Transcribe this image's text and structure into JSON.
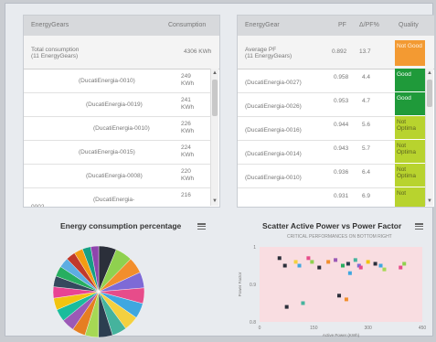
{
  "energy_table": {
    "col_gears": "EnergyGears",
    "col_consumption": "Consumption",
    "summary_label": "Total consumption",
    "summary_sub": "(11 EnergyGears)",
    "summary_value": "4306 KWh",
    "rows": [
      {
        "name": "(DucatiEnergia-0010)",
        "value": "249",
        "unit": "KWh"
      },
      {
        "name": "(DucatiEnergia-0019)",
        "value": "241",
        "unit": "KWh"
      },
      {
        "name": "(DucatiEnergia-0010)",
        "value": "226",
        "unit": "KWh"
      },
      {
        "name": "(DucatiEnergia-0015)",
        "value": "224",
        "unit": "KWh"
      },
      {
        "name": "(DucatiEnergia-0008)",
        "value": "220",
        "unit": "KWh"
      },
      {
        "name": "(DucatiEnergia-",
        "value": "216",
        "unit": "",
        "prefix": "0002"
      }
    ]
  },
  "pf_table": {
    "col_gears": "EnergyGear",
    "col_pf": "PF",
    "col_thd": "Δ/PF%",
    "col_quality": "Quality",
    "summary_label": "Average PF",
    "summary_sub": "(11 EnergyGears)",
    "summary_pf": "0.892",
    "summary_thd": "13.7",
    "summary_quality": "Not Good",
    "rows": [
      {
        "name": "(DucatiEnergia-0027)",
        "pf": "0.958",
        "thd": "4.4",
        "quality": "Good",
        "level": "good"
      },
      {
        "name": "(DucatiEnergia-0026)",
        "pf": "0.953",
        "thd": "4.7",
        "quality": "Good",
        "level": "good"
      },
      {
        "name": "(DucatiEnergia-0016)",
        "pf": "0.944",
        "thd": "5.6",
        "quality": "Not Optima",
        "level": "notopt"
      },
      {
        "name": "(DucatiEnergia-0014)",
        "pf": "0.943",
        "thd": "5.7",
        "quality": "Not Optima",
        "level": "notopt"
      },
      {
        "name": "(DucatiEnergia-0010)",
        "pf": "0.936",
        "thd": "6.4",
        "quality": "Not Optima",
        "level": "notopt"
      },
      {
        "name": "",
        "pf": "0.931",
        "thd": "6.9",
        "quality": "Not",
        "level": "notopt"
      }
    ]
  },
  "pie_chart": {
    "title": "Energy consumption percentage",
    "chart_data": {
      "type": "pie",
      "values": [
        249,
        241,
        226,
        224,
        220,
        216,
        210,
        205,
        198,
        192,
        186,
        180,
        174,
        168,
        160,
        152,
        146,
        140,
        132,
        124,
        118,
        112
      ],
      "colors": [
        "#2b2f3a",
        "#8fd14f",
        "#f28e2c",
        "#7e6ad6",
        "#e74c8a",
        "#3fa7e0",
        "#f4d03f",
        "#45b39d",
        "#2c3e50",
        "#a6d854",
        "#e67e22",
        "#9b59b6",
        "#1abc9c",
        "#f1c40f",
        "#e84393",
        "#34495e",
        "#27ae60",
        "#5dade2",
        "#c0392b",
        "#f39c12",
        "#16a085",
        "#8e44ad"
      ]
    }
  },
  "scatter_chart": {
    "title": "Scatter Active Power vs Power Factor",
    "subtitle": "CRITICAL PERFORMANCES ON BOTTOM RIGHT",
    "ylabel": "Power Factor",
    "xlabel": "Active Power (KWh)",
    "chart_data": {
      "type": "scatter",
      "xlim": [
        0,
        450
      ],
      "ylim": [
        0.8,
        1.0
      ],
      "x_ticks": [
        "0",
        "150",
        "300",
        "450"
      ],
      "y_ticks": [
        "1",
        "0.9",
        "0.8"
      ],
      "points": [
        {
          "x": 55,
          "y": 0.97,
          "color": "#2b2f3a"
        },
        {
          "x": 70,
          "y": 0.95,
          "color": "#2b2f3a"
        },
        {
          "x": 100,
          "y": 0.96,
          "color": "#f4d03f"
        },
        {
          "x": 110,
          "y": 0.95,
          "color": "#3fa7e0"
        },
        {
          "x": 135,
          "y": 0.97,
          "color": "#e74c8a"
        },
        {
          "x": 145,
          "y": 0.96,
          "color": "#8fd14f"
        },
        {
          "x": 165,
          "y": 0.945,
          "color": "#2b2f3a"
        },
        {
          "x": 190,
          "y": 0.96,
          "color": "#f28e2c"
        },
        {
          "x": 210,
          "y": 0.965,
          "color": "#9b59b6"
        },
        {
          "x": 230,
          "y": 0.95,
          "color": "#27ae60"
        },
        {
          "x": 245,
          "y": 0.955,
          "color": "#2c3e50"
        },
        {
          "x": 250,
          "y": 0.93,
          "color": "#3fa7e0"
        },
        {
          "x": 265,
          "y": 0.965,
          "color": "#45b39d"
        },
        {
          "x": 275,
          "y": 0.95,
          "color": "#7e6ad6"
        },
        {
          "x": 280,
          "y": 0.945,
          "color": "#e74c8a"
        },
        {
          "x": 300,
          "y": 0.96,
          "color": "#f1c40f"
        },
        {
          "x": 320,
          "y": 0.955,
          "color": "#2b2f3a"
        },
        {
          "x": 335,
          "y": 0.95,
          "color": "#3fa7e0"
        },
        {
          "x": 345,
          "y": 0.94,
          "color": "#a6d854"
        },
        {
          "x": 390,
          "y": 0.945,
          "color": "#e74c8a"
        },
        {
          "x": 400,
          "y": 0.955,
          "color": "#8fd14f"
        },
        {
          "x": 220,
          "y": 0.87,
          "color": "#2b2f3a"
        },
        {
          "x": 240,
          "y": 0.86,
          "color": "#f28e2c"
        },
        {
          "x": 120,
          "y": 0.85,
          "color": "#45b39d"
        },
        {
          "x": 75,
          "y": 0.84,
          "color": "#2b2f3a"
        }
      ]
    }
  }
}
